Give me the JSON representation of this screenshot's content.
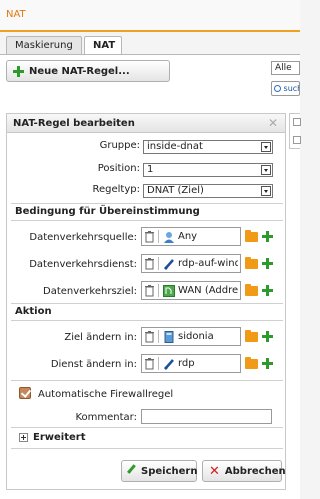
{
  "window": {
    "title": "NAT"
  },
  "tabs": [
    {
      "label": "Maskierung",
      "active": false
    },
    {
      "label": "NAT",
      "active": true
    }
  ],
  "toolbar": {
    "new_rule_label": "Neue NAT-Regel..."
  },
  "filter": {
    "selected": "Alle",
    "search_label": "such"
  },
  "dialog": {
    "title": "NAT-Regel bearbeiten",
    "close_icon": "close-icon",
    "fields": {
      "group_label": "Gruppe:",
      "group_value": "inside-dnat",
      "position_label": "Position:",
      "position_value": "1",
      "ruletype_label": "Regeltyp:",
      "ruletype_value": "DNAT (Ziel)"
    },
    "match_section": {
      "title": "Bedingung für Übereinstimmung",
      "source_label": "Datenverkehrsquelle:",
      "source_value": "Any",
      "service_label": "Datenverkehrsdienst:",
      "service_value": "rdp-auf-windo",
      "dest_label": "Datenverkehrsziel:",
      "dest_value": "WAN (Addres"
    },
    "action_section": {
      "title": "Aktion",
      "change_dest_label": "Ziel ändern in:",
      "change_dest_value": "sidonia",
      "change_service_label": "Dienst ändern in:",
      "change_service_value": "rdp"
    },
    "auto_firewall": {
      "label": "Automatische Firewallregel",
      "checked": true
    },
    "comment": {
      "label": "Kommentar:",
      "value": ""
    },
    "advanced": {
      "label": "Erweitert"
    },
    "buttons": {
      "save": "Speichern",
      "cancel": "Abbrechen"
    }
  },
  "colors": {
    "accent": "#e07a10",
    "title_underline": "#f0a020",
    "add_green": "#2e9a2e",
    "cancel_red": "#cc2222",
    "folder": "#f19a18",
    "checkbox": "#c8875a"
  }
}
